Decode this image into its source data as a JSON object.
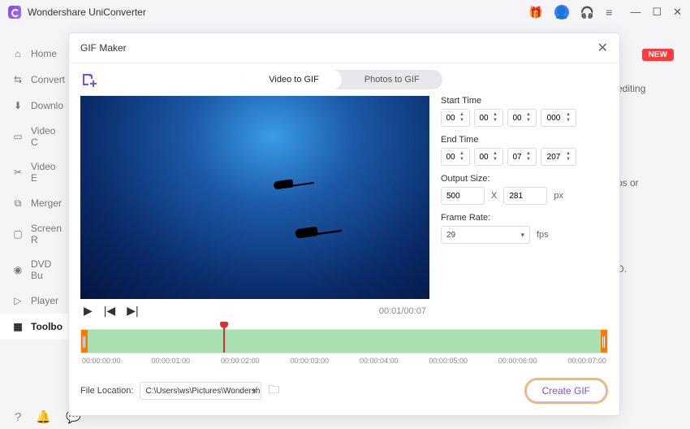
{
  "app": {
    "title": "Wondershare UniConverter"
  },
  "sidebar": {
    "items": [
      {
        "label": "Home",
        "icon": "home-icon"
      },
      {
        "label": "Convert",
        "icon": "convert-icon"
      },
      {
        "label": "Downlo",
        "icon": "download-icon"
      },
      {
        "label": "Video C",
        "icon": "compress-icon"
      },
      {
        "label": "Video E",
        "icon": "edit-icon"
      },
      {
        "label": "Merger",
        "icon": "merge-icon"
      },
      {
        "label": "Screen R",
        "icon": "screen-icon"
      },
      {
        "label": "DVD Bu",
        "icon": "dvd-icon"
      },
      {
        "label": "Player",
        "icon": "player-icon"
      },
      {
        "label": "Toolbo",
        "icon": "toolbox-icon"
      }
    ]
  },
  "badge": {
    "text": "NEW"
  },
  "bg_hints": {
    "a": "editing",
    "b": "ps or",
    "c": "D."
  },
  "modal": {
    "title": "GIF Maker",
    "tabs": {
      "video": "Video to GIF",
      "photos": "Photos to GIF"
    },
    "time_display": "00:01/00:07",
    "start": {
      "label": "Start Time",
      "hh": "00",
      "mm": "00",
      "ss": "00",
      "ms": "000"
    },
    "end": {
      "label": "End Time",
      "hh": "00",
      "mm": "00",
      "ss": "07",
      "ms": "207"
    },
    "output": {
      "label": "Output Size:",
      "w": "500",
      "x": "X",
      "h": "281",
      "unit": "px"
    },
    "frame": {
      "label": "Frame Rate:",
      "value": "29",
      "unit": "fps"
    },
    "ticks": [
      "00:00:00:00",
      "00:00:01:00",
      "00:00:02:00",
      "00:00:03:00",
      "00:00:04:00",
      "00:00:05:00",
      "00:00:06:00",
      "00:00:07:00"
    ],
    "location": {
      "label": "File Location:",
      "path": "C:\\Users\\ws\\Pictures\\Wondersh"
    },
    "create": "Create GIF"
  }
}
